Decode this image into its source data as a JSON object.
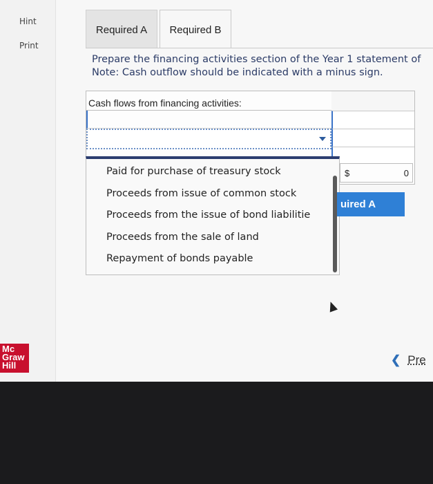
{
  "rail": {
    "hint": "Hint",
    "print": "Print"
  },
  "logo": {
    "line1": "Mc",
    "line2": "Graw",
    "line3": "Hill"
  },
  "tabs": [
    {
      "label": "Required A"
    },
    {
      "label": "Required B"
    }
  ],
  "instructions": {
    "line1": "Prepare the financing activities section of the Year 1 statement of",
    "line2": "Note: Cash outflow should be indicated with a minus sign."
  },
  "table": {
    "header": "Cash flows from financing activities:"
  },
  "dropdown": {
    "options": [
      "Paid for purchase of treasury stock",
      "Proceeds from issue of common stock",
      "Proceeds from the issue of bond liabilitie",
      "Proceeds from the sale of land",
      "Repayment of bonds payable"
    ]
  },
  "amount": {
    "currency": "$",
    "value": "0"
  },
  "nav": {
    "required_a_button": "uired A",
    "prev_label": "Pre"
  }
}
